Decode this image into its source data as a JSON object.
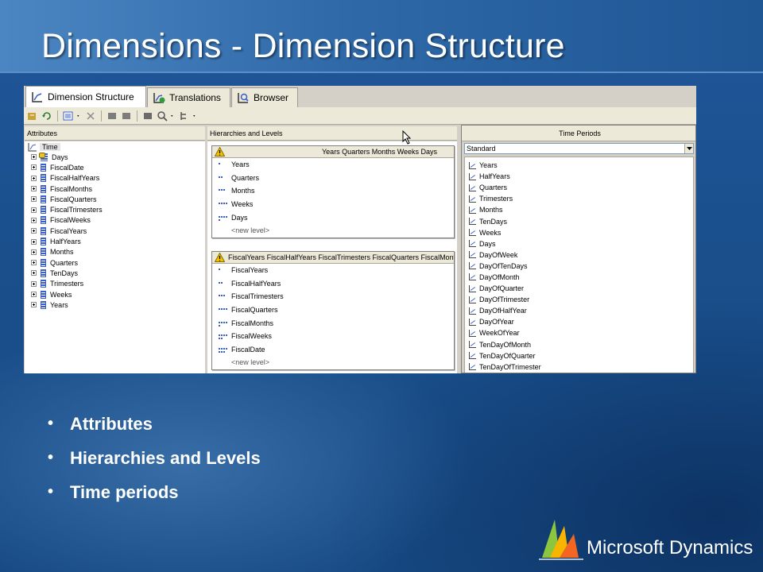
{
  "slide": {
    "title": "Dimensions - Dimension Structure",
    "bullets": [
      "Attributes",
      "Hierarchies and Levels",
      "Time periods"
    ],
    "logo_text": "Microsoft Dynamics",
    "bullet_char": "•"
  },
  "app": {
    "tabs": [
      {
        "label": "Dimension Structure",
        "icon": "dimension-structure-icon"
      },
      {
        "label": "Translations",
        "icon": "translations-icon"
      },
      {
        "label": "Browser",
        "icon": "browser-icon"
      }
    ],
    "attributes": {
      "header": "Attributes",
      "root": "Time",
      "items": [
        "Days",
        "FiscalDate",
        "FiscalHalfYears",
        "FiscalMonths",
        "FiscalQuarters",
        "FiscalTrimesters",
        "FiscalWeeks",
        "FiscalYears",
        "HalfYears",
        "Months",
        "Quarters",
        "TenDays",
        "Trimesters",
        "Weeks",
        "Years"
      ]
    },
    "hierarchies": {
      "header": "Hierarchies and Levels",
      "boxes": [
        {
          "title": "Years Quarters Months Weeks Days",
          "levels": [
            "Years",
            "Quarters",
            "Months",
            "Weeks",
            "Days"
          ],
          "new_level": "<new level>"
        },
        {
          "title": "FiscalYears FiscalHalfYears FiscalTrimesters FiscalQuarters FiscalMonths",
          "levels": [
            "FiscalYears",
            "FiscalHalfYears",
            "FiscalTrimesters",
            "FiscalQuarters",
            "FiscalMonths",
            "FiscalWeeks",
            "FiscalDate"
          ],
          "new_level": "<new level>"
        }
      ]
    },
    "time_periods": {
      "header": "Time Periods",
      "calendar": "Standard",
      "items": [
        "Years",
        "HalfYears",
        "Quarters",
        "Trimesters",
        "Months",
        "TenDays",
        "Weeks",
        "Days",
        "DayOfWeek",
        "DayOfTenDays",
        "DayOfMonth",
        "DayOfQuarter",
        "DayOfTrimester",
        "DayOfHalfYear",
        "DayOfYear",
        "WeekOfYear",
        "TenDayOfMonth",
        "TenDayOfQuarter",
        "TenDayOfTrimester"
      ]
    }
  },
  "colors": {
    "slide_background": "#1c4f86",
    "title_band": "#2f69a8",
    "attribute_icon": "#3a5fcd",
    "warning": "#f2c300"
  }
}
